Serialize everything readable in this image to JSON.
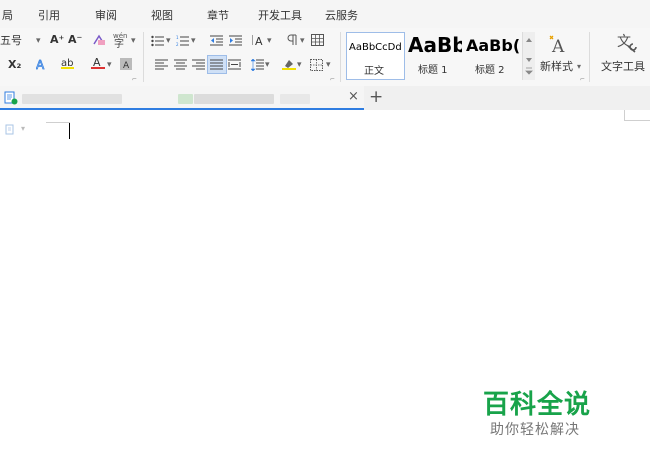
{
  "menu": [
    "局",
    "引用",
    "审阅",
    "视图",
    "章节",
    "开发工具",
    "云服务"
  ],
  "ribbon": {
    "font_size": "五号",
    "dropdown_arrow": "▾",
    "subscript_label": "X₂",
    "grow_font": "A⁺",
    "shrink_font": "A⁻",
    "pinyin_label": "wén",
    "styles_gallery": [
      {
        "preview": "AaBbCcDd",
        "label": "正文"
      },
      {
        "preview": "AaBb",
        "label": "标题 1"
      },
      {
        "preview": "AaBb(",
        "label": "标题 2"
      }
    ],
    "new_style": "新样式",
    "text_tools": "文字工具",
    "group_launcher": "⌐"
  },
  "tabs": {
    "close": "×",
    "new_tab": "+"
  },
  "watermark": {
    "title": "百科全说",
    "subtitle": "助你轻松解决"
  },
  "colors": {
    "accent": "#2f7de1",
    "brand_green": "#18a34a",
    "font_color_red": "#d33",
    "highlight_yellow": "#f2e000"
  }
}
